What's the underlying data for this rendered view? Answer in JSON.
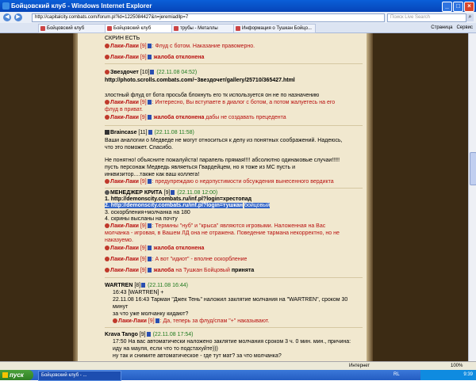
{
  "window": {
    "title": "Бойцовский клуб - Windows Internet Explorer",
    "address": "http://capitalcity.combats.com/forum.pl?id=1225084427&n=jeremiadllp=7",
    "search_placeholder": "Поиск Live Search"
  },
  "tabs": [
    {
      "label": "Бойцовский клуб"
    },
    {
      "label": "Бойцовский клуб"
    },
    {
      "label": "трубы - Металлы"
    },
    {
      "label": "Информация о Тушкан Бойцо..."
    }
  ],
  "tab_tools": {
    "page": "Страница",
    "service": "Сервис"
  },
  "posts": {
    "top_line": "СКРИН ЕСТЬ",
    "mod_name": "Лаки-Лаки",
    "mod_level": "[9]",
    "complaint_rejected": "жалоба отклонена",
    "r1": ": Флуд с ботом. Наказание правомерно.",
    "p2_author": "Звездочет",
    "p2_level": "[10]",
    "p2_date": "(22.11.08 04:52)",
    "p2_link": "http://photo.scrolls.combats.com/~3вездочет/gallery/25710/365427.html",
    "p2_text": "злостный флуд от бота просьба блокнуть его тк используется он не по назначению",
    "p2_r1": ": Интересно, Вы вступаете в диалог с ботом, а потом жалуетесь на его",
    "p2_r1b": "флуд в приват.",
    "p2_r2": "дабы не создавать прецедента",
    "p3_author": "Braincase",
    "p3_level": "[11]",
    "p3_date": "(22.11.08 11:58)",
    "p3_t1": "Ваши аналогии о Медведе не могут относиться к делу из понятных соображений. Надеюсь,",
    "p3_t2": "что это поможет. Спасибо.",
    "p3_t3": "Не понятно! объясните пожалуйста! парапель прямая!!!! абсолютно одинаковые случаи!!!!!",
    "p3_t4": " пусть персонаж Медведь являеться Гвардейцем, но я тоже из МС пусть и",
    "p3_t5": "инквизитор....также как ваш коллега!",
    "p3_r1": ": предупреждаю о недопустимости обсуждения вынесенного вердикта",
    "p4_author": "МЕНЕДЖЕР КРИТА",
    "p4_level": "[9]",
    "p4_date": "(22.11.08 12:00)",
    "p4_l1": "1. http://demonscity.combats.ru/inf.pl?login=хрестопад",
    "p4_l2": "2. http://demonscity.combats.ru/inf.pl?login=тушкан",
    "p4_l2b": "бойцовый",
    "p4_l3": "3. оскорбления+молчанка на 180",
    "p4_l4": "4. скрины высланы на почту",
    "p4_r1": ": Термины \"нуб\" и \"крыса\" являются игровыми. Наложенная на Вас",
    "p4_r1b": "молчанка - игровая, в Вашем ЛД она не отражена. Поведение тармана некорректно, но не",
    "p4_r1c": "наказуемо.",
    "p4_r2": ": А вот \"идиот\" - вполне оскорбление",
    "p4_r3a": "на Тушкан Бойцовый",
    "p4_r3b": "принята",
    "p5_author": "WARTREN",
    "p5_level": "[8]",
    "p5_date": "(22.11.08 16:44)",
    "p5_t1": "16:43 [WARTREN] +",
    "p5_t2": "22.11.08 16:43   Тарман \"Джек Тень\" наложил заклятие молчания на \"WARTREN\", сроком 30",
    "p5_t3": "минут",
    "p5_t4": "за что уже молчанку кидают?",
    "p5_r1": ": Да, теперь за флуд/спам \"+\" наказывают.",
    "p6_author": "Krava Tango",
    "p6_level": "[9]",
    "p6_date": "(22.11.08 17:54)",
    "p6_t1": "17:50 На вас автоматически наложено заклятие молчания сроком 3 ч. 0 мин. мин., причина:",
    "p6_t2": "иду на мауля, если что то подстахуйте)))",
    "p6_t3": "ну так и снимите автоматическое - где тут мат? за что молчанка?"
  },
  "statusbar": {
    "zone": "Интернет",
    "zoom": "100%"
  },
  "taskbar": {
    "start": "пуск",
    "item": "Бойцовский клуб - ...",
    "lang": "RL",
    "time": "9:39"
  }
}
